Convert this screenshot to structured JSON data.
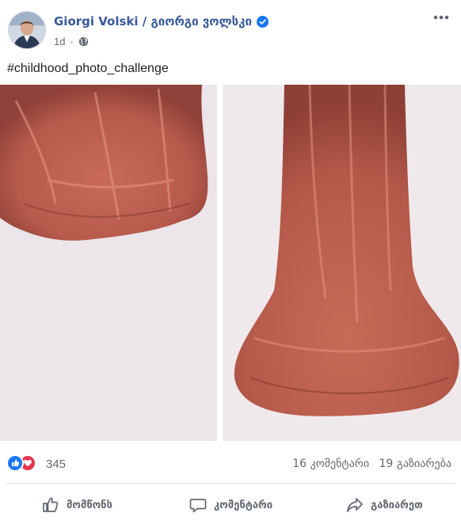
{
  "post": {
    "author": "Giorgi Volski / გიორგი ვოლსკი",
    "verified_icon": "verified-badge-icon",
    "time": "1d",
    "separator": "·",
    "privacy_icon": "globe-icon",
    "more_icon": "ellipsis-icon",
    "caption": "#childhood_photo_challenge"
  },
  "photos": {
    "left_icon": "photo",
    "right_icon": "photo"
  },
  "stats": {
    "reactions": [
      "like",
      "love"
    ],
    "reaction_count": "345",
    "comments": "16 კომენტარი",
    "shares": "19 გაზიარება"
  },
  "actions": {
    "like": "მომწონს",
    "comment": "კომენტარი",
    "share": "გაზიარეთ"
  },
  "colors": {
    "link": "#385898",
    "like_blue": "#1877f2",
    "love_red": "#e8344e",
    "muted": "#606770"
  }
}
